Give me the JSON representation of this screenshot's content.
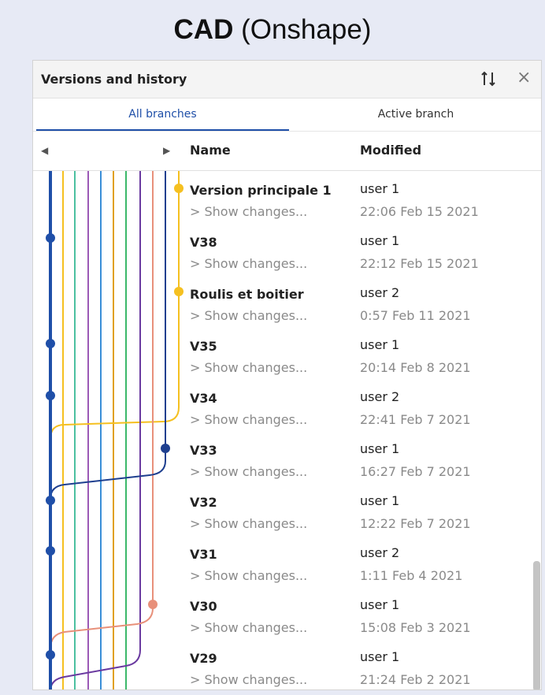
{
  "caption": {
    "bold": "CAD",
    "rest": " (Onshape)"
  },
  "panel": {
    "title": "Versions and history",
    "tabs": [
      "All branches",
      "Active branch"
    ],
    "columns": {
      "name": "Name",
      "modified": "Modified"
    },
    "show_changes_label": "> Show changes...",
    "versions": [
      {
        "name": "Version principale 1",
        "user": "user 1",
        "date": "22:06 Feb 15 2021"
      },
      {
        "name": "V38",
        "user": "user 1",
        "date": "22:12 Feb 15 2021"
      },
      {
        "name": "Roulis et boitier",
        "user": "user 2",
        "date": "0:57 Feb 11 2021"
      },
      {
        "name": "V35",
        "user": "user 1",
        "date": "20:14 Feb 8 2021"
      },
      {
        "name": "V34",
        "user": "user 2",
        "date": "22:41 Feb 7 2021"
      },
      {
        "name": "V33",
        "user": "user 1",
        "date": "16:27 Feb 7 2021"
      },
      {
        "name": "V32",
        "user": "user 1",
        "date": "12:22 Feb 7 2021"
      },
      {
        "name": "V31",
        "user": "user 2",
        "date": "1:11 Feb 4 2021"
      },
      {
        "name": "V30",
        "user": "user 1",
        "date": "15:08 Feb 3 2021"
      },
      {
        "name": "V29",
        "user": "user 1",
        "date": "21:24 Feb 2 2021"
      }
    ]
  },
  "colors": {
    "main_branch": "#1f4fa8",
    "yellow_branch": "#f5c020",
    "navy_branch": "#1e3f8f",
    "salmon_branch": "#e8907a",
    "purple_branch": "#6a3aa0",
    "accent": "#1f4fa8"
  }
}
